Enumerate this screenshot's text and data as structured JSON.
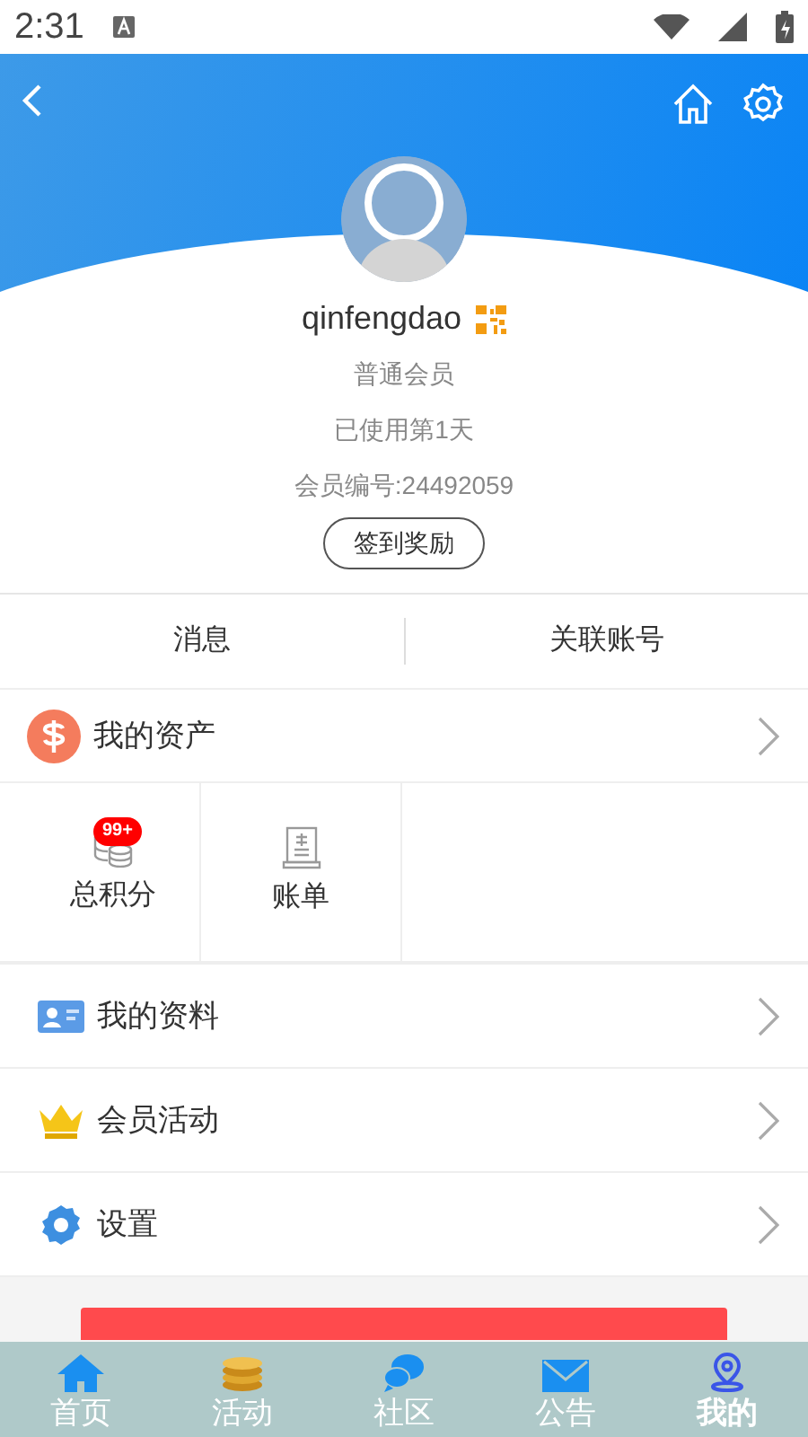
{
  "status_bar": {
    "time": "2:31"
  },
  "profile": {
    "username": "qinfengdao",
    "level": "普通会员",
    "days_used": "已使用第1天",
    "member_no": "会员编号:24492059",
    "checkin_button": "签到奖励"
  },
  "tabs": [
    {
      "label": "消息"
    },
    {
      "label": "关联账号"
    }
  ],
  "assets": {
    "title": "我的资产",
    "items": [
      {
        "kind": "points",
        "label": "总积分",
        "badge": "99+"
      },
      {
        "kind": "bill",
        "label": "账单"
      }
    ]
  },
  "menu": [
    {
      "kind": "profile",
      "label": "我的资料"
    },
    {
      "kind": "activity",
      "label": "会员活动"
    },
    {
      "kind": "settings",
      "label": "设置"
    }
  ],
  "bottom_nav": [
    {
      "kind": "home",
      "label": "首页",
      "selected": false
    },
    {
      "kind": "activity",
      "label": "活动",
      "selected": false
    },
    {
      "kind": "community",
      "label": "社区",
      "selected": false
    },
    {
      "kind": "notice",
      "label": "公告",
      "selected": false
    },
    {
      "kind": "mine",
      "label": "我的",
      "selected": true
    }
  ]
}
